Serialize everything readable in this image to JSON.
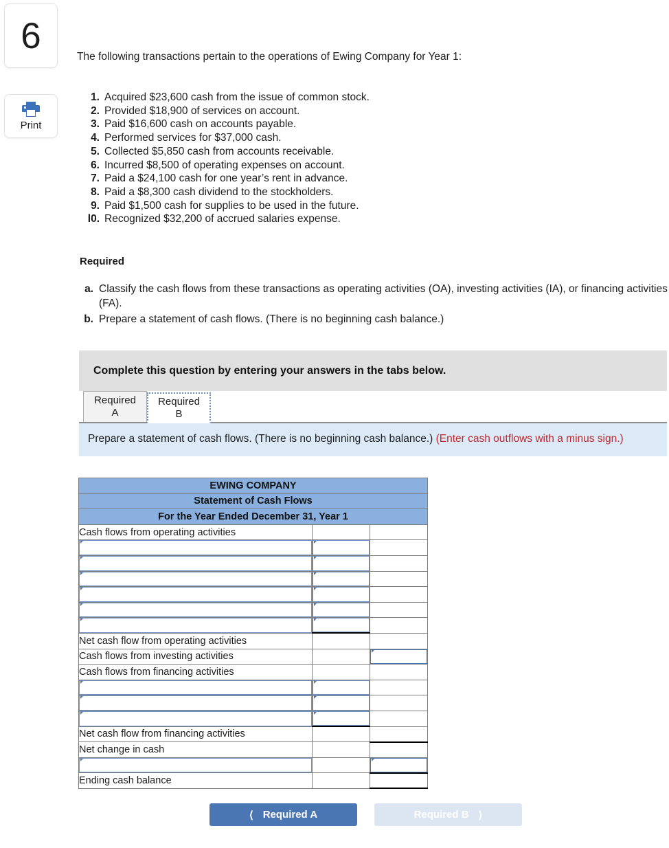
{
  "question_number": "6",
  "print_button": {
    "label": "Print",
    "icon": "printer-icon"
  },
  "intro": "The following transactions pertain to the operations of Ewing Company for Year 1:",
  "transactions": [
    {
      "num": "1.",
      "text": "Acquired $23,600 cash from the issue of common stock."
    },
    {
      "num": "2.",
      "text": "Provided $18,900 of services on account."
    },
    {
      "num": "3.",
      "text": "Paid $16,600 cash on accounts payable."
    },
    {
      "num": "4.",
      "text": "Performed services for $37,000 cash."
    },
    {
      "num": "5.",
      "text": "Collected $5,850 cash from accounts receivable."
    },
    {
      "num": "6.",
      "text": "Incurred $8,500 of operating expenses on account."
    },
    {
      "num": "7.",
      "text": "Paid a $24,100 cash for one year’s rent in advance."
    },
    {
      "num": "8.",
      "text": "Paid a $8,300 cash dividend to the stockholders."
    },
    {
      "num": "9.",
      "text": "Paid $1,500 cash for supplies to be used in the future."
    },
    {
      "num": "l0.",
      "text": "Recognized $32,200 of accrued salaries expense."
    }
  ],
  "required_heading": "Required",
  "required_items": [
    {
      "letter": "a.",
      "text": "Classify the cash flows from these transactions as operating activities (OA), investing activities (IA), or financing activities (FA)."
    },
    {
      "letter": "b.",
      "text": "Prepare a statement of cash flows. (There is no beginning cash balance.)"
    }
  ],
  "widget": {
    "banner": "Complete this question by entering your answers in the tabs below.",
    "tabs": [
      {
        "line1": "Required",
        "line2": "A",
        "active": false
      },
      {
        "line1": "Required",
        "line2": "B",
        "active": true
      }
    ],
    "instruction_main": "Prepare a statement of cash flows. (There is no beginning cash balance.) ",
    "instruction_note": "(Enter cash outflows with a minus sign.)"
  },
  "statement": {
    "title_lines": [
      "EWING COMPANY",
      "Statement of Cash Flows",
      "For the Year Ended December 31, Year 1"
    ],
    "rows": [
      {
        "label": "Cash flows from operating activities",
        "type": "label"
      },
      {
        "label": "",
        "type": "input",
        "col2": "input"
      },
      {
        "label": "",
        "type": "input",
        "col2": "input"
      },
      {
        "label": "",
        "type": "input",
        "col2": "input"
      },
      {
        "label": "",
        "type": "input",
        "col2": "input"
      },
      {
        "label": "",
        "type": "input",
        "col2": "input"
      },
      {
        "label": "",
        "type": "input",
        "col2": "input-ruled"
      },
      {
        "label": "Net cash flow from operating activities",
        "type": "label"
      },
      {
        "label": "Cash flows from investing activities",
        "type": "label",
        "col3": "selected"
      },
      {
        "label": "Cash flows from financing activities",
        "type": "label"
      },
      {
        "label": "",
        "type": "input",
        "col2": "input"
      },
      {
        "label": "",
        "type": "input",
        "col2": "input"
      },
      {
        "label": "",
        "type": "input",
        "col2": "input-ruled"
      },
      {
        "label": "Net cash flow from financing activities",
        "type": "label"
      },
      {
        "label": "Net change in cash",
        "type": "label",
        "col3": "ruled"
      },
      {
        "label": "",
        "type": "input",
        "col3": "selected-ruled"
      },
      {
        "label": "Ending cash balance",
        "type": "label",
        "col3": "double-ruled"
      }
    ]
  },
  "nav": {
    "prev_label": "Required A",
    "prev_icon": "chevron-left-icon",
    "next_label": "Required B",
    "next_icon": "chevron-right-icon"
  },
  "colors": {
    "accent_blue": "#4a77b4",
    "header_blue": "#8ab0e0",
    "panel_blue": "#dceaf7",
    "banner_gray": "#e0e0e0",
    "red_note": "#c0272d"
  }
}
